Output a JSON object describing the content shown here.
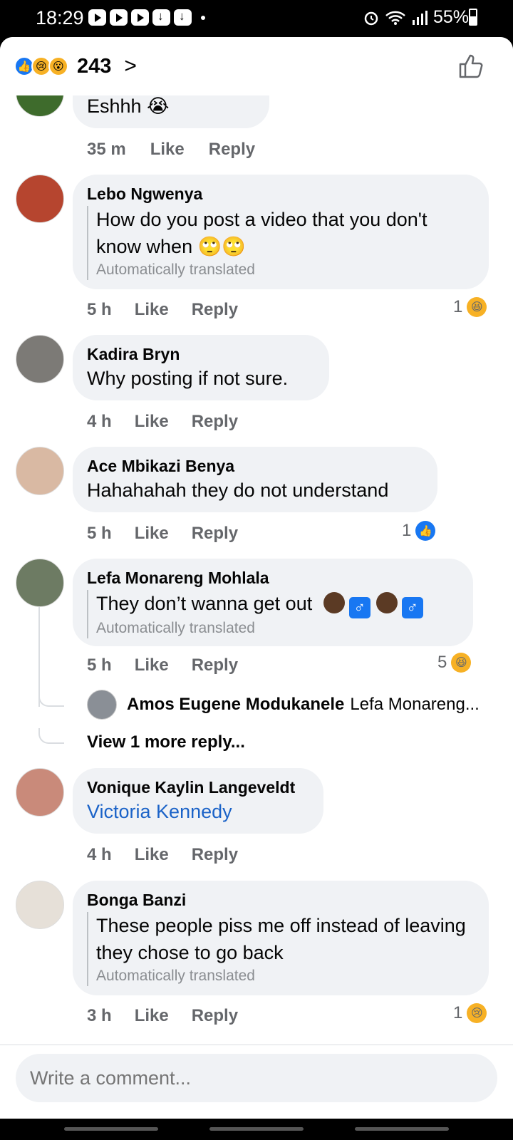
{
  "status_bar": {
    "time": "18:29",
    "battery": "55%"
  },
  "header": {
    "reaction_count": "243",
    "reaction_icons": [
      "like-icon",
      "sad-icon",
      "wow-icon"
    ]
  },
  "comments": [
    {
      "text": "Eshhh 😭",
      "time": "35 m",
      "like_label": "Like",
      "reply_label": "Reply"
    },
    {
      "name": "Lebo Ngwenya",
      "text": "How do you post a video that you don't know when 🙄🙄",
      "translated_note": "Automatically translated",
      "time": "5 h",
      "like_label": "Like",
      "reply_label": "Reply",
      "reaction_count": "1",
      "reaction_icon": "haha-icon"
    },
    {
      "name": "Kadira Bryn",
      "text": "Why posting if not sure.",
      "time": "4 h",
      "like_label": "Like",
      "reply_label": "Reply"
    },
    {
      "name": "Ace Mbikazi Benya",
      "text": "Hahahahah they do not understand",
      "time": "5 h",
      "like_label": "Like",
      "reply_label": "Reply",
      "reaction_count": "1",
      "reaction_icon": "like-icon"
    },
    {
      "name": "Lefa Monareng Mohlala",
      "text": "They don’t wanna get out",
      "translated_note": "Automatically translated",
      "time": "5 h",
      "like_label": "Like",
      "reply_label": "Reply",
      "reaction_count": "5",
      "reaction_icon": "haha-icon",
      "reply_preview": {
        "name": "Amos Eugene Modukanele",
        "text": "Lefa Monareng..."
      },
      "view_more": "View 1 more reply..."
    },
    {
      "name": "Vonique Kaylin Langeveldt",
      "text": "Victoria Kennedy",
      "time": "4 h",
      "like_label": "Like",
      "reply_label": "Reply"
    },
    {
      "name": "Bonga Banzi",
      "text": "These people piss me off instead of leaving they chose to go back",
      "translated_note": "Automatically translated",
      "time": "3 h",
      "like_label": "Like",
      "reply_label": "Reply",
      "reaction_count": "1",
      "reaction_icon": "sad-icon"
    }
  ],
  "composer": {
    "placeholder": "Write a comment..."
  },
  "colors": {
    "accent": "#1877f2",
    "bubble": "#f0f2f5",
    "meta": "#65676b",
    "mention": "#1b63c8"
  }
}
